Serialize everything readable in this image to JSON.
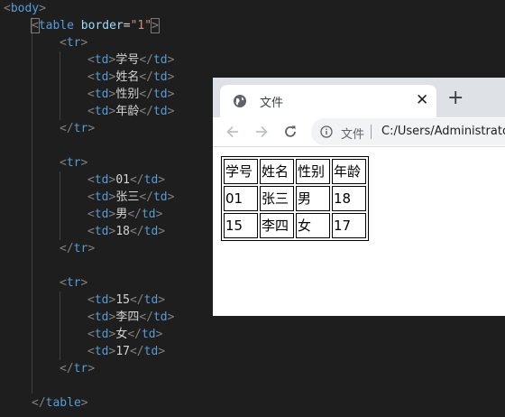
{
  "editor": {
    "body_open_tag": "body",
    "table_open": {
      "tag": "table",
      "attr_name": "border",
      "attr_value": "\"1\""
    },
    "rows": [
      [
        "学号",
        "姓名",
        "性别",
        "年龄"
      ],
      [
        "01",
        "张三",
        "男",
        "18"
      ],
      [
        "15",
        "李四",
        "女",
        "17"
      ]
    ],
    "tr_tag": "tr",
    "td_tag": "td",
    "table_close": "table"
  },
  "browser": {
    "tab_title": "文件",
    "tab_close": "✕",
    "new_tab": "+",
    "omnibox_label": "文件",
    "omnibox_url": "C:/Users/Administrator",
    "table": [
      [
        "学号",
        "姓名",
        "性别",
        "年龄"
      ],
      [
        "01",
        "张三",
        "男",
        "18"
      ],
      [
        "15",
        "李四",
        "女",
        "17"
      ]
    ]
  },
  "colors": {
    "editor_bg": "#1e1e1e",
    "tag": "#569cd6",
    "attr": "#9cdcfe",
    "string": "#ce9178",
    "text": "#d4d4d4",
    "tabstrip": "#dee1e6"
  }
}
